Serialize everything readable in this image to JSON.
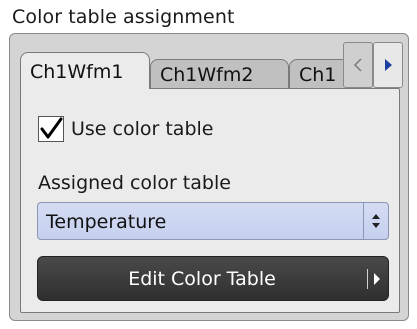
{
  "panel": {
    "title": "Color table assignment"
  },
  "tabs": [
    {
      "label": "Ch1Wfm1",
      "active": true
    },
    {
      "label": "Ch1Wfm2",
      "active": false
    },
    {
      "label": "Ch1",
      "active": false
    }
  ],
  "tab_scroll": {
    "left_icon": "triangle-left-icon",
    "right_icon": "triangle-right-icon"
  },
  "use_color_table": {
    "label": "Use color table",
    "checked": true
  },
  "assigned_color_table": {
    "label": "Assigned color table",
    "value": "Temperature",
    "accent_color": "#c8d2ef"
  },
  "edit_button": {
    "label": "Edit Color Table",
    "icon": "triangle-right-icon"
  }
}
